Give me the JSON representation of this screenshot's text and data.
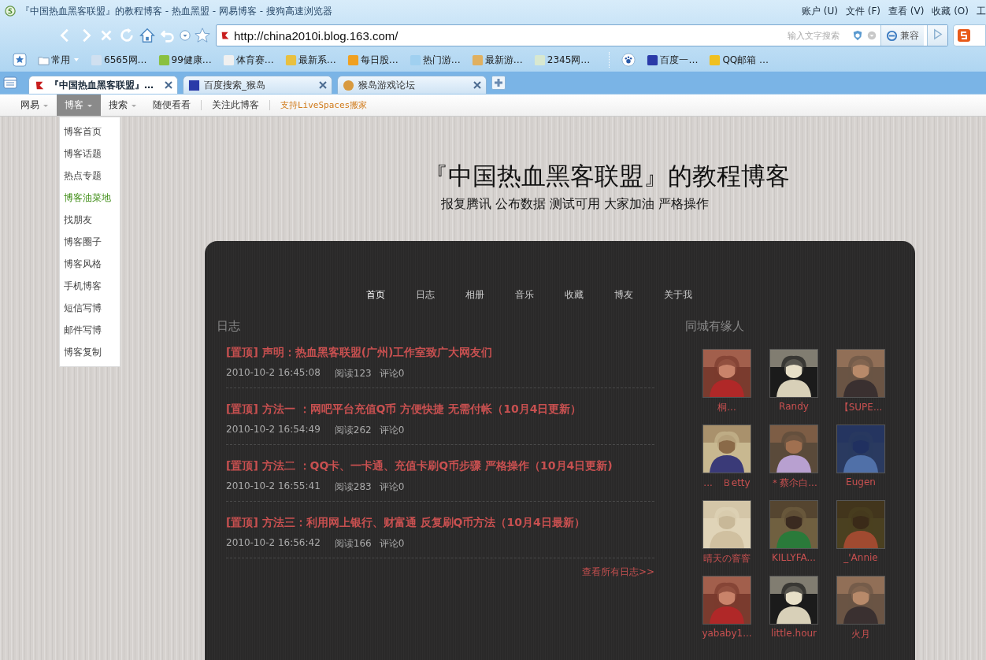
{
  "window": {
    "title": "『中国热血黑客联盟』的教程博客 - 热血黑盟 - 网易博客 - 搜狗高速浏览器"
  },
  "menu": [
    "账户 (U)",
    "文件 (F)",
    "查看 (V)",
    "收藏 (O)",
    "工"
  ],
  "address_bar": {
    "url": "http://china2010i.blog.163.com/",
    "search_placeholder": "输入文字搜索",
    "compat_button": "兼容"
  },
  "bookmarks": [
    "常用",
    "6565网…",
    "99健康…",
    "体育赛…",
    "最新系…",
    "每日股…",
    "热门游…",
    "最新游…",
    "2345网…"
  ],
  "bookmarks_right": [
    "百度一…",
    "QQ邮箱 …"
  ],
  "tabs": [
    {
      "label": "『中国热血黑客联盟』…",
      "selected": true
    },
    {
      "label": "百度搜索_猴岛",
      "selected": false
    },
    {
      "label": "猴岛游戏论坛",
      "selected": false
    }
  ],
  "blog_bar": {
    "items": [
      {
        "label": "网易",
        "dropdown": true,
        "selected": false
      },
      {
        "label": "博客",
        "dropdown": true,
        "selected": true
      },
      {
        "label": "搜索",
        "dropdown": true,
        "selected": false
      },
      {
        "label": "随便看看",
        "dropdown": false,
        "selected": false
      },
      {
        "label": "关注此博客",
        "dropdown": false,
        "selected": false
      }
    ],
    "promo": "支持LiveSpaces搬家"
  },
  "dropdown": [
    {
      "label": "博客首页",
      "highlighted": false
    },
    {
      "label": "博客话题",
      "highlighted": false
    },
    {
      "label": "热点专题",
      "highlighted": false
    },
    {
      "label": "博客油菜地",
      "highlighted": true
    },
    {
      "label": "找朋友",
      "highlighted": false
    },
    {
      "label": "博客圈子",
      "highlighted": false
    },
    {
      "label": "博客风格",
      "highlighted": false
    },
    {
      "label": "手机博客",
      "highlighted": false
    },
    {
      "label": "短信写博",
      "highlighted": false
    },
    {
      "label": "邮件写博",
      "highlighted": false
    },
    {
      "label": "博客复制",
      "highlighted": false
    }
  ],
  "blog": {
    "title": "『中国热血黑客联盟』的教程博客",
    "subtitle": "报复腾讯 公布数据 测试可用 大家加油 严格操作",
    "nav": [
      {
        "label": "首页",
        "selected": true
      },
      {
        "label": "日志",
        "selected": false
      },
      {
        "label": "相册",
        "selected": false
      },
      {
        "label": "音乐",
        "selected": false
      },
      {
        "label": "收藏",
        "selected": false
      },
      {
        "label": "博友",
        "selected": false
      },
      {
        "label": "关于我",
        "selected": false
      }
    ],
    "posts_heading": "日志",
    "posts": [
      {
        "title": "[置顶] 声明：热血黑客联盟(广州)工作室致广大网友们",
        "date": "2010-10-2 16:45:08",
        "reads": "阅读123",
        "comments": "评论0"
      },
      {
        "title": "[置顶] 方法一 ：网吧平台充值Q币 方便快捷 无需付帐（10月4日更新）",
        "date": "2010-10-2 16:54:49",
        "reads": "阅读262",
        "comments": "评论0"
      },
      {
        "title": "[置顶] 方法二 ：QQ卡、一卡通、充值卡刷Q币步骤 严格操作（10月4日更新)",
        "date": "2010-10-2 16:55:41",
        "reads": "阅读283",
        "comments": "评论0"
      },
      {
        "title": "[置顶] 方法三：利用网上银行、财富通 反复刷Q币方法（10月4日最新）",
        "date": "2010-10-2 16:56:42",
        "reads": "阅读166",
        "comments": "评论0"
      }
    ],
    "more_link": "查看所有日志>>",
    "friends_heading": "同城有缘人",
    "friends": [
      {
        "name": "桐..."
      },
      {
        "name": "Randy"
      },
      {
        "name": "【SUPE..."
      },
      {
        "name": "...　Ｂetty"
      },
      {
        "name": "＊蔡尒白..."
      },
      {
        "name": "Eugen"
      },
      {
        "name": "晴天の窨窨"
      },
      {
        "name": "KILLYFA..."
      },
      {
        "name": "_'Annie"
      },
      {
        "name": "yababy1..."
      },
      {
        "name": "little.hour"
      },
      {
        "name": "火月"
      }
    ]
  }
}
